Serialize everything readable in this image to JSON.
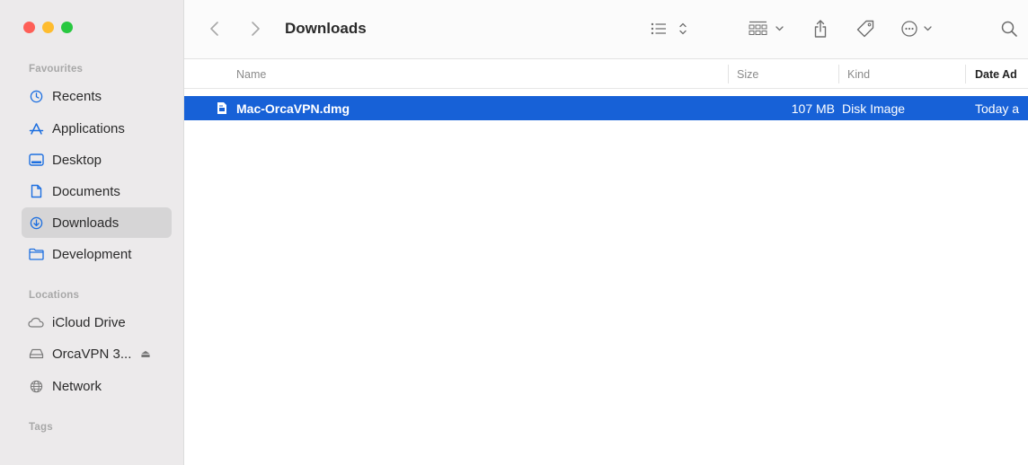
{
  "sidebar": {
    "favourites_title": "Favourites",
    "favourites": [
      {
        "label": "Recents",
        "icon": "clock-icon"
      },
      {
        "label": "Applications",
        "icon": "applications-icon"
      },
      {
        "label": "Desktop",
        "icon": "desktop-icon"
      },
      {
        "label": "Documents",
        "icon": "document-icon"
      },
      {
        "label": "Downloads",
        "icon": "downloads-icon",
        "active": true
      },
      {
        "label": "Development",
        "icon": "folder-icon"
      }
    ],
    "locations_title": "Locations",
    "locations": [
      {
        "label": "iCloud Drive",
        "icon": "cloud-icon"
      },
      {
        "label": "OrcaVPN 3...",
        "icon": "disk-icon",
        "eject": true
      },
      {
        "label": "Network",
        "icon": "network-icon"
      }
    ],
    "tags_title": "Tags"
  },
  "toolbar": {
    "title": "Downloads",
    "buttons": [
      "back-icon",
      "forward-icon",
      "list-view-icon",
      "group-icon",
      "share-icon",
      "tag-icon",
      "more-icon",
      "search-icon"
    ]
  },
  "columns": {
    "name": "Name",
    "size": "Size",
    "kind": "Kind",
    "date": "Date Ad"
  },
  "files": [
    {
      "name": "Mac-OrcaVPN.dmg",
      "size": "107 MB",
      "kind": "Disk Image",
      "date": "Today a",
      "selected": true
    }
  ],
  "colors": {
    "selection": "#1761d7",
    "sidebar_bg": "#eceaeb",
    "close": "#fe5f57",
    "minimize": "#febc2e",
    "zoom": "#28c840"
  }
}
